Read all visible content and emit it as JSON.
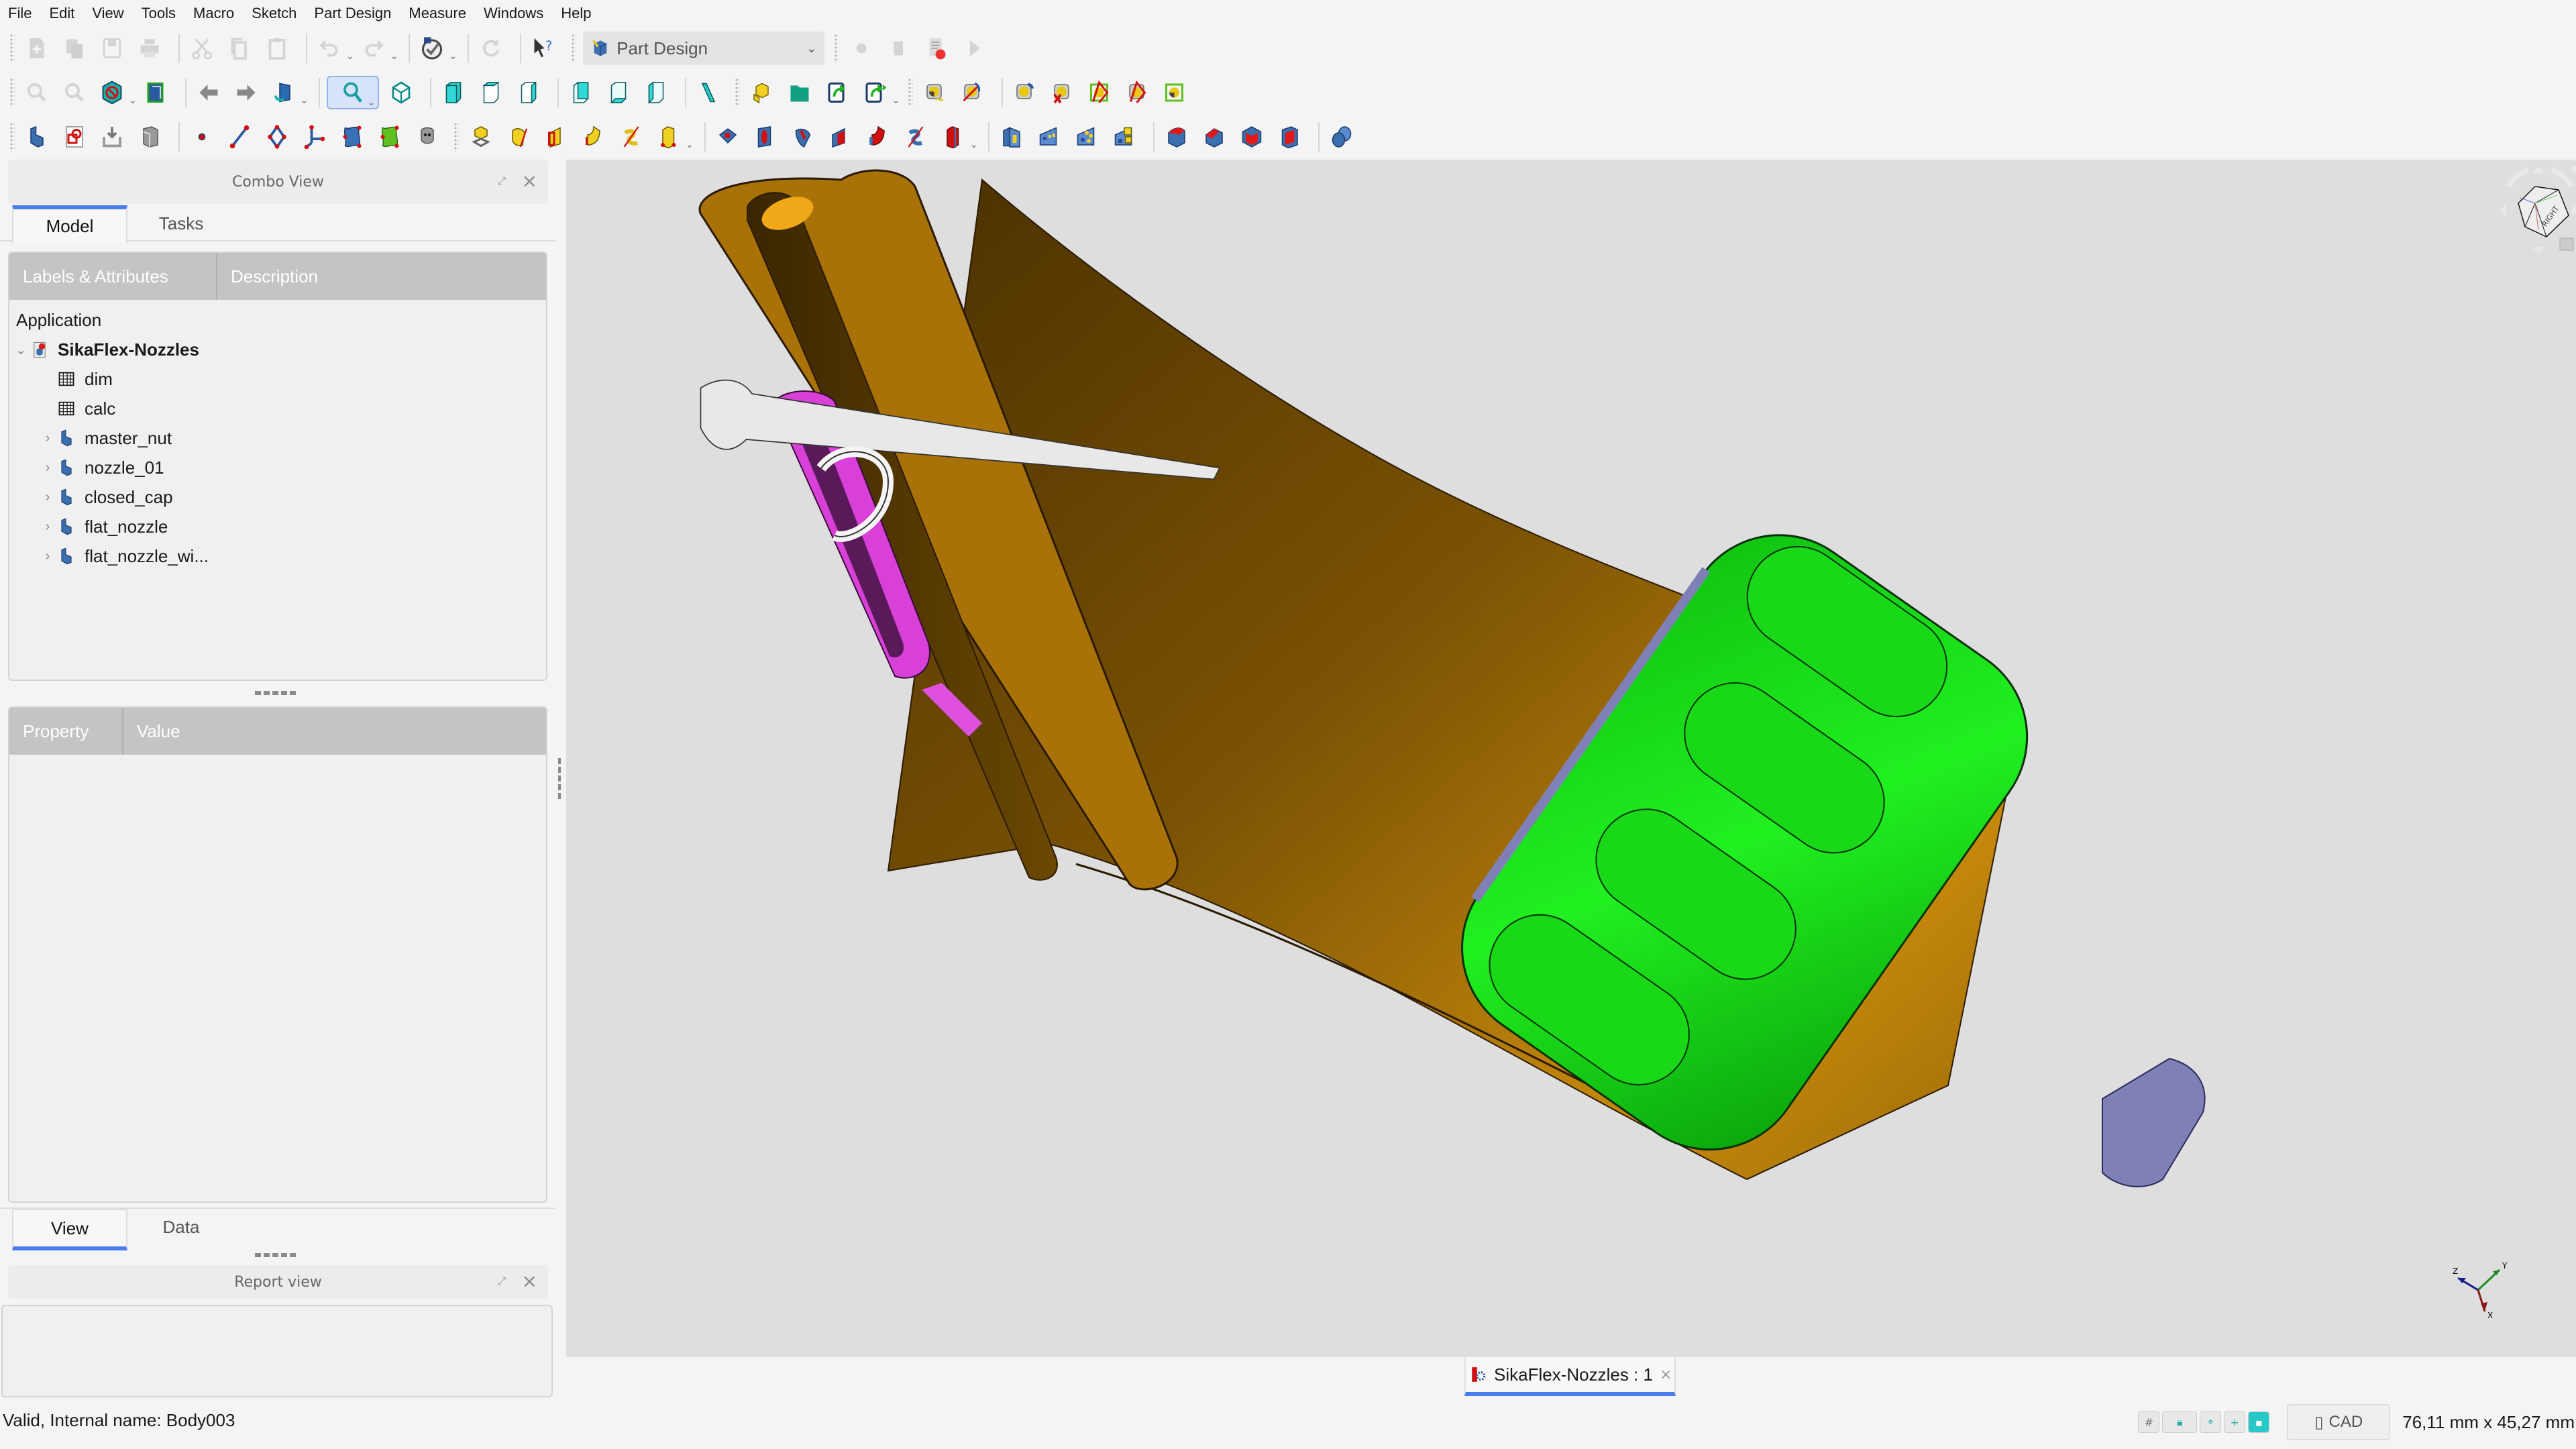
{
  "menu": [
    "File",
    "Edit",
    "View",
    "Tools",
    "Macro",
    "Sketch",
    "Part Design",
    "Measure",
    "Windows",
    "Help"
  ],
  "toolbar": {
    "workbench_selector": "Part Design",
    "row1_icons": [
      "new-file-icon",
      "open-file-icon",
      "save-icon",
      "print-icon",
      "cut-icon",
      "copy-icon",
      "paste-icon",
      "undo-icon",
      "redo-icon",
      "refresh-check-icon",
      "refresh-icon",
      "whats-this-icon"
    ],
    "macro_icons": [
      "macro-record-icon",
      "macro-stop-icon",
      "macro-edit-icon",
      "macro-run-icon"
    ],
    "row2_icons": [
      "fit-all-icon",
      "fit-selection-icon",
      "draw-style-icon",
      "bounding-box-icon",
      "back-icon",
      "forward-icon",
      "std-view-icon",
      "zoom-icon",
      "isometric-view-icon",
      "front-view-icon",
      "top-view-icon",
      "right-view-icon",
      "rear-view-icon",
      "bottom-view-icon",
      "left-view-icon",
      "measure-distance-icon",
      "part-icon",
      "group-icon",
      "link-icon",
      "link-sub-icon",
      "measure-icon",
      "measure-refresh-icon",
      "measure-toggle-icon",
      "measure-clear-icon",
      "measure-toggle3d-icon",
      "measure-toggle-delta-icon",
      "measure-toggle-all-icon"
    ],
    "row3_icons": [
      "body-icon",
      "shapebinder-icon",
      "subshape-binder-icon",
      "clone-icon",
      "datum-point-icon",
      "datum-line-icon",
      "datum-plane-icon",
      "local-cs-icon",
      "sketch-icon",
      "validate-sketch-icon",
      "sketch-map-icon",
      "pad-icon",
      "revolution-icon",
      "additive-loft-icon",
      "additive-pipe-icon",
      "additive-helix-icon",
      "additive-primitive-icon",
      "pocket-icon",
      "hole-icon",
      "groove-icon",
      "subtractive-loft-icon",
      "subtractive-pipe-icon",
      "subtractive-helix-icon",
      "subtractive-primitive-icon",
      "mirrored-icon",
      "linear-pattern-icon",
      "polar-pattern-icon",
      "multitransform-icon",
      "fillet-icon",
      "chamfer-icon",
      "draft-icon",
      "thickness-icon",
      "boolean-icon"
    ]
  },
  "combo_view": {
    "title": "Combo View",
    "tabs": [
      "Model",
      "Tasks"
    ],
    "selected_tab": "Model",
    "tree_columns": [
      "Labels & Attributes",
      "Description"
    ],
    "tree": {
      "root_label": "Application",
      "document": "SikaFlex-Nozzles",
      "items": [
        {
          "label": "dim",
          "icon": "spreadsheet-icon",
          "expandable": false
        },
        {
          "label": "calc",
          "icon": "spreadsheet-icon",
          "expandable": false
        },
        {
          "label": "master_nut",
          "icon": "body-icon",
          "expandable": true
        },
        {
          "label": "nozzle_01",
          "icon": "body-icon",
          "expandable": true
        },
        {
          "label": "closed_cap",
          "icon": "body-icon",
          "expandable": true
        },
        {
          "label": "flat_nozzle",
          "icon": "body-icon",
          "expandable": true
        },
        {
          "label": "flat_nozzle_wi...",
          "icon": "body-icon",
          "expandable": true
        }
      ]
    },
    "property_columns": [
      "Property",
      "Value"
    ],
    "bottom_tabs": [
      "View",
      "Data"
    ],
    "selected_bottom_tab": "View"
  },
  "report_view": {
    "title": "Report view",
    "content": ""
  },
  "viewport": {
    "navcube_face": "RIGHT",
    "axis_labels": [
      "X",
      "Y",
      "Z"
    ],
    "model_colors": {
      "nozzle": "#b07a10",
      "insert": "#d640d6",
      "nut": "#14e014",
      "thread": "#8080b8",
      "tip": "#e8e8e8"
    }
  },
  "document_tab": {
    "label": "SikaFlex-Nozzles : 1"
  },
  "status_bar": {
    "message": "Valid, Internal name: Body003",
    "nav_style": "CAD",
    "dimensions": "76,11 mm x 45,27 mm"
  },
  "colors": {
    "accent": "#4a7cf0",
    "viewport_bg": "#dedede"
  }
}
